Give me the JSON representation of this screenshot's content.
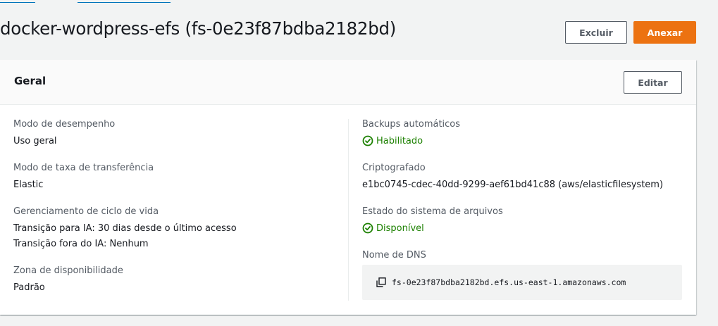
{
  "breadcrumbs": [],
  "title": "docker-wordpress-efs (fs-0e23f87bdba2182bd)",
  "actions": {
    "delete_label": "Excluir",
    "attach_label": "Anexar"
  },
  "panel": {
    "title": "Geral",
    "edit_label": "Editar",
    "left": [
      {
        "label": "Modo de desempenho",
        "values": [
          "Uso geral"
        ]
      },
      {
        "label": "Modo de taxa de transferência",
        "values": [
          "Elastic"
        ]
      },
      {
        "label": "Gerenciamento de ciclo de vida",
        "values": [
          "Transição para IA: 30 dias desde o último acesso",
          "Transição fora do IA: Nenhum"
        ]
      },
      {
        "label": "Zona de disponibilidade",
        "values": [
          "Padrão"
        ]
      }
    ],
    "right": {
      "backups": {
        "label": "Backups automáticos",
        "status": "Habilitado",
        "icon": "check-circle-icon"
      },
      "encrypted": {
        "label": "Criptografado",
        "value": "e1bc0745-cdec-40dd-9299-aef61bd41c88 (aws/elasticfilesystem)"
      },
      "state": {
        "label": "Estado do sistema de arquivos",
        "status": "Disponível",
        "icon": "check-circle-icon"
      },
      "dns": {
        "label": "Nome de DNS",
        "value": "fs-0e23f87bdba2182bd.efs.us-east-1.amazonaws.com",
        "icon": "copy-icon"
      }
    }
  },
  "colors": {
    "accent": "#ec7211",
    "success": "#1d8102",
    "link": "#0073bb"
  }
}
